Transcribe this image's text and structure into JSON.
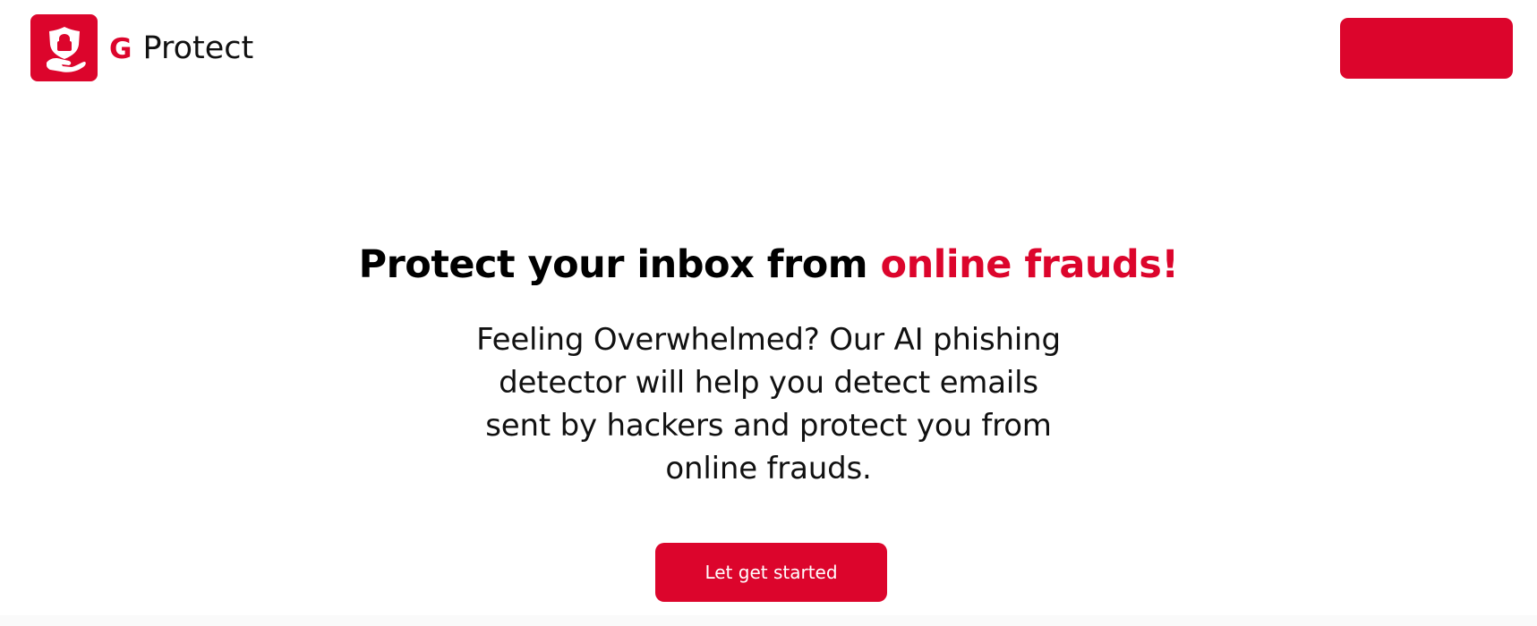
{
  "brand": {
    "logo_icon": "shield-hand-icon",
    "initial": "G",
    "name": "Protect"
  },
  "header": {
    "action_button_label": ""
  },
  "hero": {
    "title_main": "Protect your inbox from ",
    "title_accent": "online frauds!",
    "subtitle": "Feeling Overwhelmed? Our AI phishing detector will help you detect emails sent by hackers and protect you from online frauds.",
    "cta_label": "Let get started"
  },
  "colors": {
    "accent": "#dc052c",
    "text": "#000000",
    "background": "#ffffff"
  }
}
